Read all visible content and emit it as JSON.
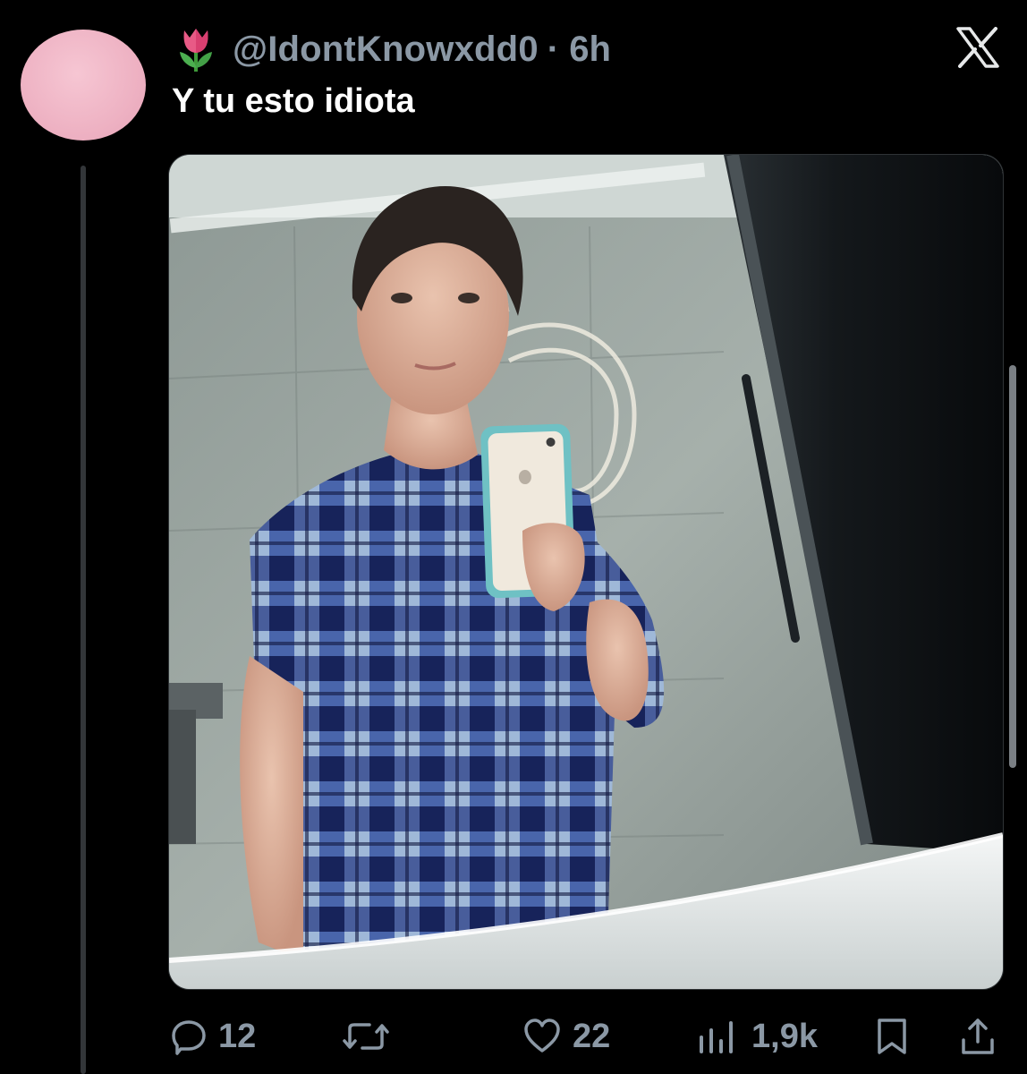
{
  "tweet": {
    "handle": "@IdontKnowxdd0",
    "time": "· 6h",
    "text": "Y tu esto idiota",
    "avatar_color": "#f0b6c6",
    "emoji_icon": "tulip-icon",
    "platform_icon": "x-logo-icon"
  },
  "media": {
    "description_icon": "photo"
  },
  "actions": {
    "replies": "12",
    "likes": "22",
    "views": "1,9k"
  },
  "colors": {
    "background": "#000000",
    "text": "#ffffff",
    "muted": "#8b98a5"
  }
}
